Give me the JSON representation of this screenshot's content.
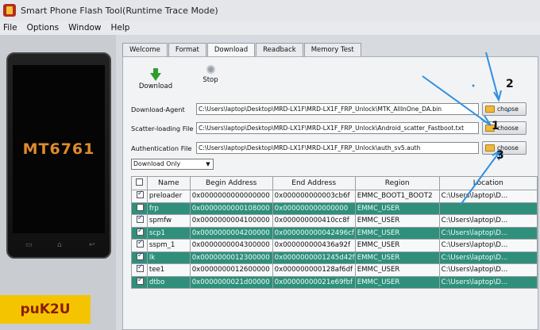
{
  "window": {
    "title": "Smart Phone Flash Tool(Runtime Trace Mode)"
  },
  "menu": [
    "File",
    "Options",
    "Window",
    "Help"
  ],
  "phone": {
    "chip": "MT6761"
  },
  "brand": "puK2U",
  "tabs": [
    "Welcome",
    "Format",
    "Download",
    "Readback",
    "Memory Test"
  ],
  "toolbar": {
    "download_label": "Download",
    "stop_label": "Stop"
  },
  "fields": {
    "download_agent": {
      "label": "Download-Agent",
      "value": "C:\\Users\\laptop\\Desktop\\MRD-LX1F\\MRD-LX1F_FRP_Unlock\\MTK_AllInOne_DA.bin"
    },
    "scatter": {
      "label": "Scatter-loading File",
      "value": "C:\\Users\\laptop\\Desktop\\MRD-LX1F\\MRD-LX1F_FRP_Unlock\\Android_scatter_Fastboot.txt"
    },
    "auth": {
      "label": "Authentication File",
      "value": "C:\\Users\\laptop\\Desktop\\MRD-LX1F\\MRD-LX1F_FRP_Unlock\\auth_sv5.auth"
    },
    "choose_label": "choose"
  },
  "mode": {
    "selected": "Download Only"
  },
  "table": {
    "headers": [
      "Name",
      "Begin Address",
      "End Address",
      "Region",
      "Location"
    ],
    "rows": [
      {
        "name": "preloader",
        "begin": "0x0000000000000000",
        "end": "0x000000000003cb6f",
        "region": "EMMC_BOOT1_BOOT2",
        "location": "C:\\Users\\laptop\\D...",
        "checked": true
      },
      {
        "name": "frp",
        "begin": "0x0000000000108000",
        "end": "0x000000000000000",
        "region": "EMMC_USER",
        "location": "",
        "checked": false
      },
      {
        "name": "spmfw",
        "begin": "0x0000000004100000",
        "end": "0x000000000410cc8f",
        "region": "EMMC_USER",
        "location": "C:\\Users\\laptop\\D...",
        "checked": true
      },
      {
        "name": "scp1",
        "begin": "0x0000000004200000",
        "end": "0x000000000042496cf",
        "region": "EMMC_USER",
        "location": "C:\\Users\\laptop\\D...",
        "checked": true
      },
      {
        "name": "sspm_1",
        "begin": "0x0000000004300000",
        "end": "0x000000000436a92f",
        "region": "EMMC_USER",
        "location": "C:\\Users\\laptop\\D...",
        "checked": true
      },
      {
        "name": "lk",
        "begin": "0x0000000012300000",
        "end": "0x0000000001245d42f",
        "region": "EMMC_USER",
        "location": "C:\\Users\\laptop\\D...",
        "checked": true
      },
      {
        "name": "tee1",
        "begin": "0x0000000012600000",
        "end": "0x000000000128af6df",
        "region": "EMMC_USER",
        "location": "C:\\Users\\laptop\\D...",
        "checked": true
      },
      {
        "name": "dtbo",
        "begin": "0x0000000021d00000",
        "end": "0x00000000021e69fbf",
        "region": "EMMC_USER",
        "location": "C:\\Users\\laptop\\D...",
        "checked": true
      }
    ]
  },
  "annotations": [
    "1",
    "2",
    "3"
  ],
  "colors": {
    "row_alt": "#2f8f7a",
    "brand_bg": "#f5c400",
    "chip_text": "#e08b2a",
    "arrow": "#2f8fe0"
  }
}
